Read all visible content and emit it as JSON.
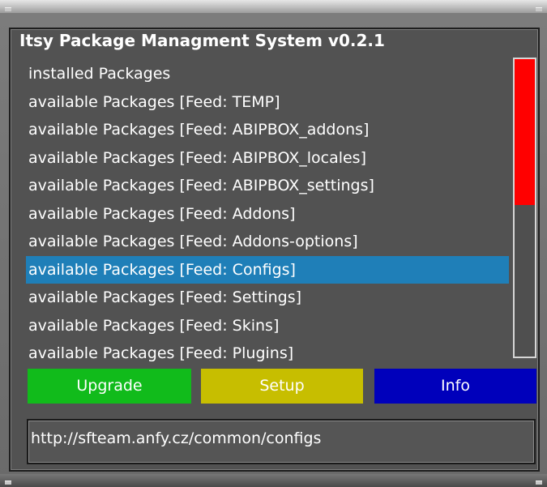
{
  "colors": {
    "background": "#525252",
    "selected_row": "#1f7fb8",
    "scroll_thumb": "#ff0000",
    "upgrade_button": "#11bb1b",
    "setup_button": "#c7be00",
    "info_button": "#0000bb",
    "text": "#ffffff"
  },
  "window": {
    "title": "Itsy Package Managment System v0.2.1"
  },
  "package_list": {
    "selected_index": 7,
    "items": [
      {
        "label": "installed Packages"
      },
      {
        "label": "available Packages [Feed: TEMP]"
      },
      {
        "label": "available Packages [Feed: ABIPBOX_addons]"
      },
      {
        "label": "available Packages [Feed: ABIPBOX_locales]"
      },
      {
        "label": "available Packages [Feed: ABIPBOX_settings]"
      },
      {
        "label": "available Packages [Feed: Addons]"
      },
      {
        "label": "available Packages [Feed: Addons-options]"
      },
      {
        "label": "available Packages [Feed: Configs]"
      },
      {
        "label": "available Packages [Feed: Settings]"
      },
      {
        "label": "available Packages [Feed: Skins]"
      },
      {
        "label": "available Packages [Feed: Plugins]"
      }
    ]
  },
  "scrollbar": {
    "thumb_fraction": 0.49
  },
  "buttons": {
    "upgrade_label": "Upgrade",
    "setup_label": "Setup",
    "info_label": "Info"
  },
  "status": {
    "url": "http://sfteam.anfy.cz/common/configs"
  }
}
